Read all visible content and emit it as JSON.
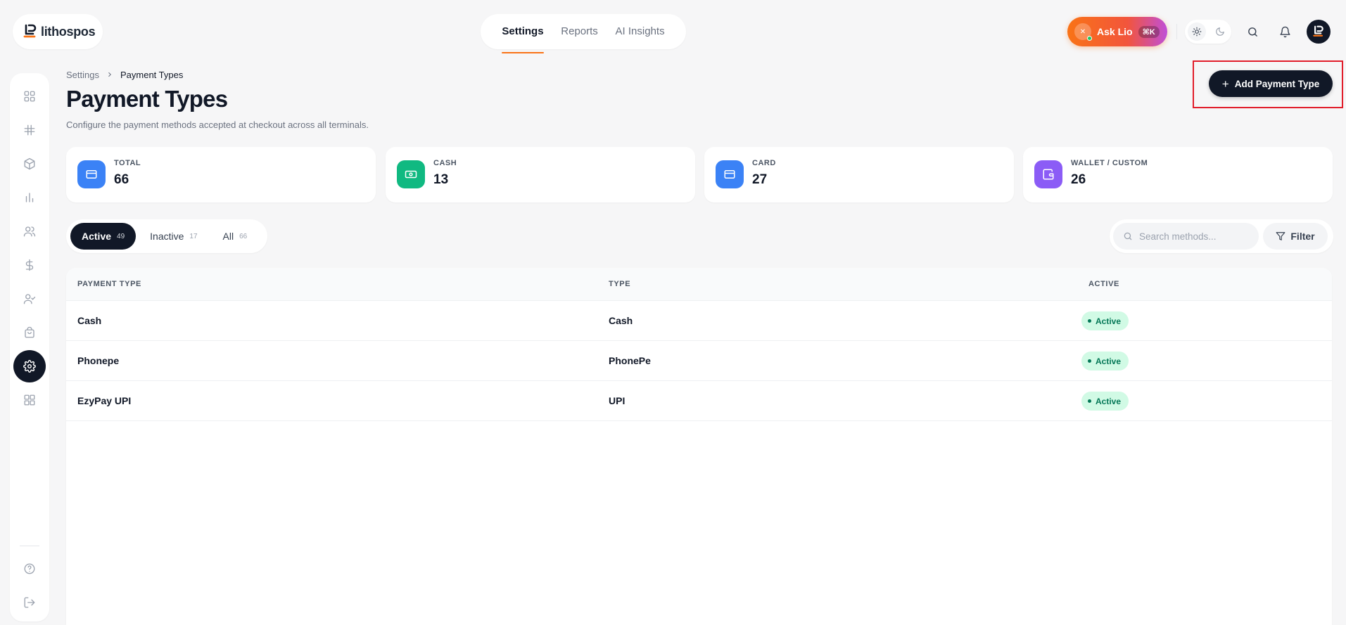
{
  "brand": {
    "name": "lithospos"
  },
  "topnav": {
    "tabs": [
      {
        "label": "Settings"
      },
      {
        "label": "Reports"
      },
      {
        "label": "AI Insights"
      }
    ]
  },
  "assistant": {
    "label": "Ask Lio",
    "shortcut": "⌘K"
  },
  "breadcrumb": {
    "parent": "Settings",
    "current": "Payment Types"
  },
  "page": {
    "title": "Payment Types",
    "subtitle": "Configure the payment methods accepted at checkout across all terminals.",
    "add_button": "Add Payment Type"
  },
  "stats": [
    {
      "label": "TOTAL",
      "value": "66",
      "icon": "card-icon",
      "color": "#3b82f6"
    },
    {
      "label": "CASH",
      "value": "13",
      "icon": "cash-icon",
      "color": "#10b981"
    },
    {
      "label": "CARD",
      "value": "27",
      "icon": "card-icon",
      "color": "#3b82f6"
    },
    {
      "label": "WALLET / CUSTOM",
      "value": "26",
      "icon": "wallet-icon",
      "color": "#8b5cf6"
    }
  ],
  "segments": [
    {
      "label": "Active",
      "count": "49"
    },
    {
      "label": "Inactive",
      "count": "17"
    },
    {
      "label": "All",
      "count": "66"
    }
  ],
  "search": {
    "placeholder": "Search methods..."
  },
  "filter": {
    "label": "Filter"
  },
  "table": {
    "headers": [
      "PAYMENT TYPE",
      "TYPE",
      "ACTIVE"
    ],
    "rows": [
      {
        "name": "Cash",
        "type": "Cash",
        "status": "Active"
      },
      {
        "name": "Phonepe",
        "type": "PhonePe",
        "status": "Active"
      },
      {
        "name": "EzyPay UPI",
        "type": "UPI",
        "status": "Active"
      }
    ]
  },
  "colors": {
    "accent": "#f97316",
    "dark": "#111827",
    "success": "#047857",
    "success_bg": "#d1fae5"
  }
}
